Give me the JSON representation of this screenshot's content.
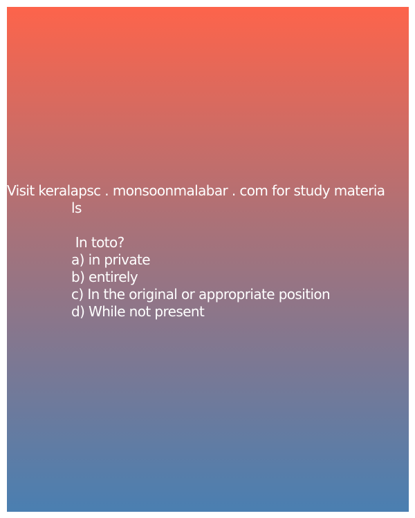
{
  "banner": {
    "line1": "Visit keralapsc . monsoonmalabar . com for study materia",
    "line2": "ls"
  },
  "question": {
    "text": " In toto?",
    "options": [
      "a) in private",
      "b) entirely",
      "c) In the original or appropriate position",
      "d) While not present"
    ]
  },
  "colors": {
    "gradient_top": "#fd644b",
    "gradient_bottom": "#4a7fb1",
    "text": "#ffffff"
  }
}
